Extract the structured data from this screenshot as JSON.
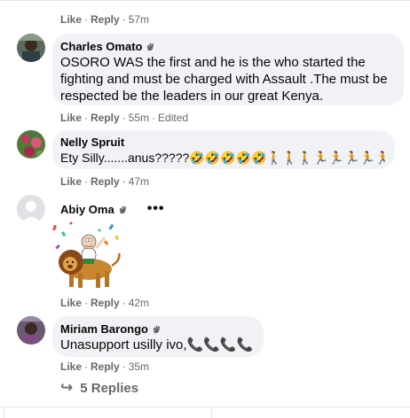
{
  "comments": [
    {
      "meta": {
        "like": "Like",
        "reply": "Reply",
        "time": "57m",
        "edited": ""
      }
    },
    {
      "author": "Charles Omato",
      "text": "OSORO WAS the first and he is the who started the fighting and must be charged with Assault .The must be respected be the leaders in our great Kenya.",
      "meta": {
        "like": "Like",
        "reply": "Reply",
        "time": "55m",
        "edited": "Edited"
      }
    },
    {
      "author": "Nelly Spruit",
      "text": "Ety Silly.......anus?????🤣🤣🤣🤣🤣🚶🚶🚶🏃🏃🏃🏃🏃",
      "meta": {
        "like": "Like",
        "reply": "Reply",
        "time": "47m",
        "edited": ""
      }
    },
    {
      "author": "Abiy Oma",
      "more": "•••",
      "sticker": "lion-rider-sticker",
      "meta": {
        "like": "Like",
        "reply": "Reply",
        "time": "42m",
        "edited": ""
      }
    },
    {
      "author": "Miriam Barongo",
      "text": "Unasupport usilly ivo,📞📞📞📞",
      "meta": {
        "like": "Like",
        "reply": "Reply",
        "time": "35m",
        "edited": ""
      }
    }
  ],
  "replies": {
    "arrow": "↪",
    "label": "5 Replies"
  },
  "icons": {
    "wave": "waving-hand-icon",
    "reply_arrow": "reply-arrow-icon"
  }
}
